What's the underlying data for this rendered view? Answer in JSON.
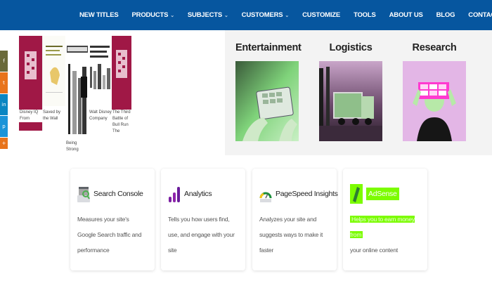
{
  "nav": {
    "items": [
      {
        "label": "NEW TITLES",
        "dropdown": false
      },
      {
        "label": "PRODUCTS",
        "dropdown": true
      },
      {
        "label": "SUBJECTS",
        "dropdown": true
      },
      {
        "label": "CUSTOMERS",
        "dropdown": true
      },
      {
        "label": "CUSTOMIZE",
        "dropdown": false
      },
      {
        "label": "TOOLS",
        "dropdown": false
      },
      {
        "label": "ABOUT US",
        "dropdown": false
      },
      {
        "label": "BLOG",
        "dropdown": false
      },
      {
        "label": "CONTACT US",
        "dropdown": false
      }
    ],
    "caret": "⌄",
    "background": "#06569f"
  },
  "social": {
    "buttons": [
      {
        "icon": "facebook-icon",
        "glyph": "f",
        "color": "#3b5998"
      },
      {
        "icon": "twitter-icon",
        "glyph": "t",
        "color": "#e8741c"
      },
      {
        "icon": "linkedin-icon",
        "glyph": "in",
        "color": "#0a86c2"
      },
      {
        "icon": "pinterest-icon",
        "glyph": "p",
        "color": "#1b94d8"
      },
      {
        "icon": "more-icon",
        "glyph": "+",
        "color": "#e8741c"
      }
    ]
  },
  "books": {
    "captions": [
      "Disney IQ From",
      "Saved by the Wall",
      "Being Strong",
      "Walt Disney Company",
      "The Third Battle of Bull Run The"
    ],
    "covers": [
      {
        "title": "",
        "color": "#a01846"
      },
      {
        "title": "Saved by the Wall",
        "color": "#ffffff"
      },
      {
        "title": "Cam Pal Tu",
        "color": "#ffffff"
      },
      {
        "title": "Company Success Strategy",
        "color": "#ffffff"
      },
      {
        "title": "",
        "color": "#a01846"
      }
    ]
  },
  "categories": [
    {
      "title": "Entertainment"
    },
    {
      "title": "Logistics"
    },
    {
      "title": "Research"
    }
  ],
  "cards": [
    {
      "title": "Search Console",
      "icon": "search-console-icon",
      "desc": "Measures your site's Google Search traffic and performance",
      "highlight": false
    },
    {
      "title": "Analytics",
      "icon": "analytics-icon",
      "desc": "Tells you how users find, use, and engage with your site",
      "highlight": false
    },
    {
      "title": "PageSpeed Insights",
      "icon": "pagespeed-icon",
      "desc": "Analyzes your site and suggests ways to make it faster",
      "highlight": false
    },
    {
      "title": "AdSense",
      "icon": "adsense-icon",
      "desc_highlight": "Helps you to earn money from",
      "desc_rest": "your online content",
      "highlight": true
    }
  ],
  "colors": {
    "accent": "#7cfc00",
    "brand": "#06569f"
  }
}
